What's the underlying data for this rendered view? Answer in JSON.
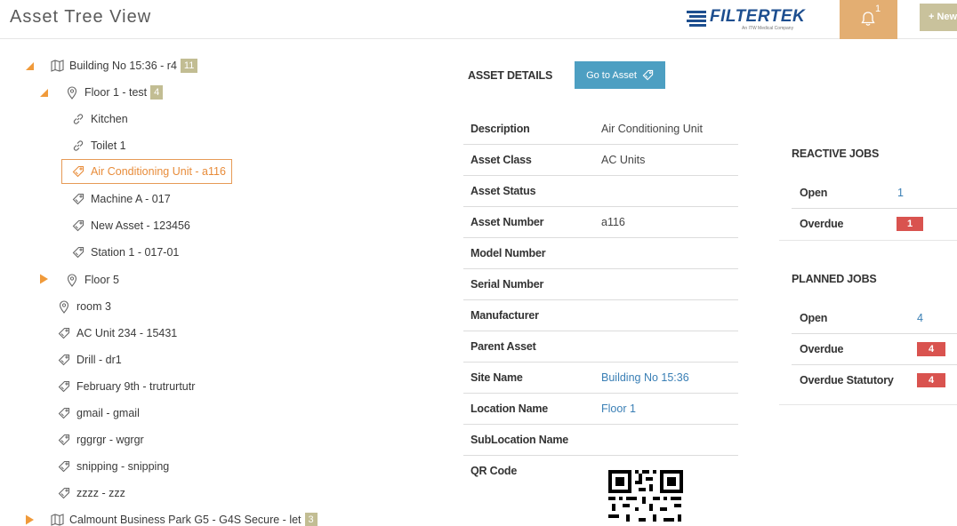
{
  "header": {
    "title": "Asset Tree View",
    "logo_text": "FILTERTEK",
    "logo_subtext": "An ITW Medical Company",
    "notification_count": "1",
    "new_label": "+ New"
  },
  "tree": {
    "building": {
      "label": "Building No 15:36 - r4",
      "count": "11"
    },
    "floor1": {
      "label": "Floor 1 - test",
      "count": "4"
    },
    "kitchen": "Kitchen",
    "toilet": "Toilet 1",
    "aircon": "Air Conditioning Unit - a116",
    "machine": "Machine A - 017",
    "newasset": "New Asset - 123456",
    "station": "Station 1 - 017-01",
    "floor5": "Floor 5",
    "room3": "room 3",
    "acunit": "AC Unit 234 - 15431",
    "drill": "Drill - dr1",
    "feb": "February 9th - trutrurtutr",
    "gmail": "gmail - gmail",
    "rgg": "rggrgr - wgrgr",
    "snipping": "snipping - snipping",
    "zzzz": "zzzz - zzz",
    "calmount": {
      "label": "Calmount Business Park G5 - G4S Secure - let",
      "count": "3"
    }
  },
  "details": {
    "title": "ASSET DETAILS",
    "goto_label": "Go to Asset",
    "rows": [
      {
        "label": "Description",
        "value": "Air Conditioning Unit"
      },
      {
        "label": "Asset Class",
        "value": "AC Units"
      },
      {
        "label": "Asset Status",
        "value": ""
      },
      {
        "label": "Asset Number",
        "value": "a116"
      },
      {
        "label": "Model Number",
        "value": ""
      },
      {
        "label": "Serial Number",
        "value": ""
      },
      {
        "label": "Manufacturer",
        "value": ""
      },
      {
        "label": "Parent Asset",
        "value": ""
      },
      {
        "label": "Site Name",
        "value": "Building No 15:36"
      },
      {
        "label": "Location Name",
        "value": "Floor 1"
      },
      {
        "label": "SubLocation Name",
        "value": ""
      },
      {
        "label": "QR Code",
        "value": ""
      }
    ]
  },
  "reactive": {
    "title": "REACTIVE JOBS",
    "open_label": "Open",
    "open_value": "1",
    "overdue_label": "Overdue",
    "overdue_value": "1"
  },
  "planned": {
    "title": "PLANNED JOBS",
    "open_label": "Open",
    "open_value": "4",
    "overdue_label": "Overdue",
    "overdue_value": "4",
    "statutory_label": "Overdue Statutory",
    "statutory_value": "4"
  },
  "colors": {
    "accent": "#e3ae72",
    "selected": "#e88c3a",
    "button": "#4d9fc2",
    "badge": "#c2bd93",
    "danger": "#d9534f",
    "link": "#3a7fb5"
  }
}
